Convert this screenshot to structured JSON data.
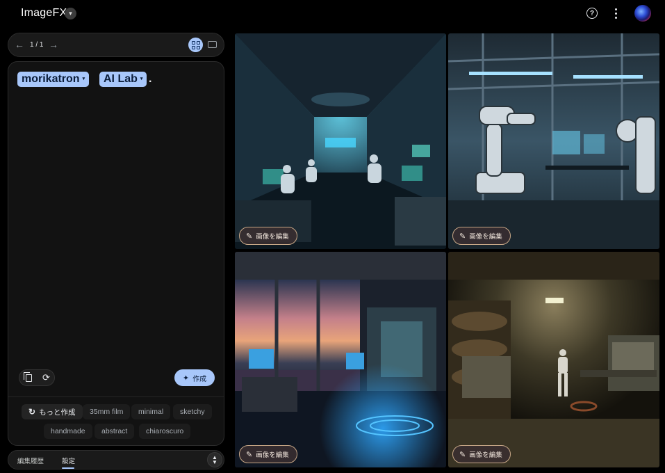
{
  "header": {
    "app_title": "ImageFX",
    "title_dropdown_icon": "chevron-down-icon",
    "help_icon": "help-circle-icon",
    "more_icon": "more-vert-icon",
    "avatar_icon": "user-avatar"
  },
  "pager": {
    "prev_icon": "arrow-left-icon",
    "count": "1 / 1",
    "next_icon": "arrow-right-icon",
    "grid_view_icon": "grid-view-icon",
    "single_view_icon": "single-view-icon"
  },
  "prompt": {
    "chips": [
      {
        "label": "morikatron",
        "caret": "▾"
      },
      {
        "label": "AI Lab",
        "caret": "▾"
      }
    ],
    "trailing_text": ".",
    "create_label": "作成",
    "create_icon": "sparkle-icon",
    "copy_icon": "copy-icon",
    "reset_icon": "reset-icon"
  },
  "suggestions": {
    "more_label": "もっと作成",
    "items": [
      "35mm film",
      "minimal",
      "sketchy",
      "handmade",
      "abstract",
      "chiaroscuro"
    ]
  },
  "bottom_tabs": {
    "history_label": "編集履歴",
    "settings_label": "設定",
    "active": "settings"
  },
  "images": [
    {
      "edit_label": "画像を編集",
      "scene": "research lab with scientists at computer workstations"
    },
    {
      "edit_label": "画像を編集",
      "scene": "robotic arms in blue-lit lab"
    },
    {
      "edit_label": "画像を編集",
      "scene": "lab with city skyline at dusk and holographic floor"
    },
    {
      "edit_label": "画像を編集",
      "scene": "dim industrial basement with robot"
    }
  ],
  "colors": {
    "accent": "#a8c7fa",
    "background": "#000000",
    "panel": "#121212",
    "edit_border": "#c7a787"
  }
}
